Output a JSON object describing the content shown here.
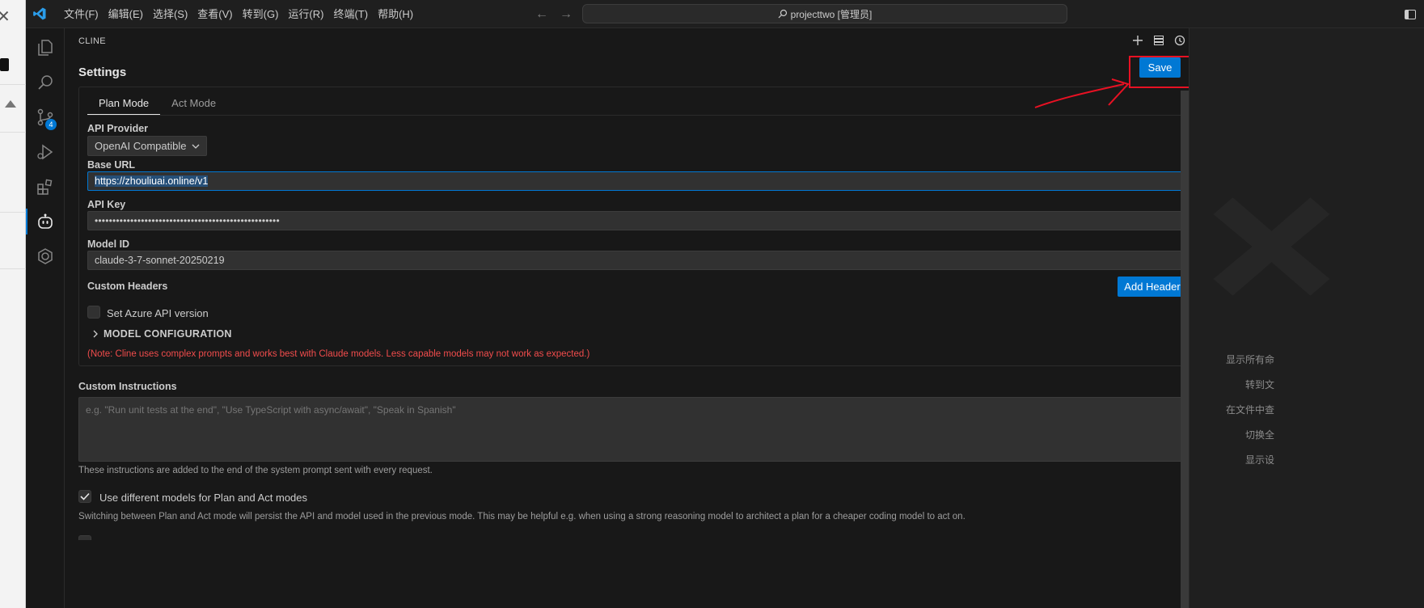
{
  "window": {
    "title": "projecttwo [管理员]",
    "menus": [
      "文件(F)",
      "编辑(E)",
      "选择(S)",
      "查看(V)",
      "转到(G)",
      "运行(R)",
      "终端(T)",
      "帮助(H)"
    ]
  },
  "activity_bar": {
    "source_control_badge": "4"
  },
  "panel": {
    "header": "CLINE",
    "settings_title": "Settings",
    "save_label": "Save",
    "tabs": [
      "Plan Mode",
      "Act Mode"
    ],
    "api_provider": {
      "label": "API Provider",
      "selected": "OpenAI Compatible"
    },
    "base_url": {
      "label": "Base URL",
      "value": "https://zhouliuai.online/v1"
    },
    "api_key": {
      "label": "API Key",
      "value": "••••••••••••••••••••••••••••••••••••••••••••••••••••"
    },
    "model_id": {
      "label": "Model ID",
      "value": "claude-3-7-sonnet-20250219"
    },
    "custom_headers": {
      "label": "Custom Headers",
      "button": "Add Header"
    },
    "azure_checkbox": {
      "label": "Set Azure API version",
      "checked": false
    },
    "model_configuration": "MODEL CONFIGURATION",
    "note": "(Note: Cline uses complex prompts and works best with Claude models. Less capable models may not work as expected.)",
    "custom_instructions": {
      "label": "Custom Instructions",
      "placeholder": "e.g. \"Run unit tests at the end\", \"Use TypeScript with async/await\", \"Speak in Spanish\"",
      "help": "These instructions are added to the end of the system prompt sent with every request."
    },
    "different_models": {
      "label": "Use different models for Plan and Act modes",
      "checked": true,
      "help": "Switching between Plan and Act mode will persist the API and model used in the previous mode. This may be helpful e.g. when using a strong reasoning model to architect a plan for a cheaper coding model to act on."
    }
  },
  "editor": {
    "shortcuts": [
      "显示所有命",
      "转到文",
      "在文件中查",
      "切换全",
      "显示设"
    ]
  },
  "colors": {
    "accent": "#0078d4",
    "annotation": "#e81123",
    "warning": "#f14c4c"
  }
}
